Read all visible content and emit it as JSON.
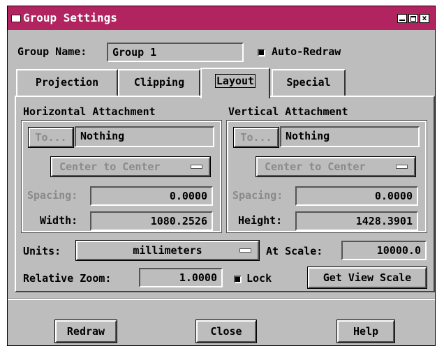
{
  "window": {
    "title": "Group Settings"
  },
  "group_name": {
    "label": "Group Name:",
    "value": "Group 1"
  },
  "auto_redraw": {
    "label": "Auto-Redraw",
    "checked": true
  },
  "tabs": [
    {
      "label": "Projection",
      "active": false
    },
    {
      "label": "Clipping",
      "active": false
    },
    {
      "label": "Layout",
      "active": true
    },
    {
      "label": "Special",
      "active": false
    }
  ],
  "horizontal": {
    "heading": "Horizontal Attachment",
    "to_label": "To...",
    "attached_to": "Nothing",
    "mode": "Center to Center",
    "spacing_label": "Spacing:",
    "spacing": "0.0000",
    "size_label": "Width:",
    "size": "1080.2526"
  },
  "vertical": {
    "heading": "Vertical Attachment",
    "to_label": "To...",
    "attached_to": "Nothing",
    "mode": "Center to Center",
    "spacing_label": "Spacing:",
    "spacing": "0.0000",
    "size_label": "Height:",
    "size": "1428.3901"
  },
  "units": {
    "label": "Units:",
    "value": "millimeters"
  },
  "at_scale": {
    "label": "At Scale:",
    "value": "10000.0"
  },
  "relative_zoom": {
    "label": "Relative Zoom:",
    "value": "1.0000"
  },
  "lock": {
    "label": "Lock",
    "checked": true
  },
  "get_view_scale": {
    "label": "Get View Scale"
  },
  "footer": {
    "redraw": "Redraw",
    "close": "Close",
    "help": "Help"
  },
  "colors": {
    "titlebar": "#b1245f",
    "dialog": "#bdbdbd"
  },
  "icons": {
    "window_menu": "window-menu-icon",
    "minimize": "minimize-icon",
    "maximize": "maximize-icon",
    "close": "close-icon"
  }
}
